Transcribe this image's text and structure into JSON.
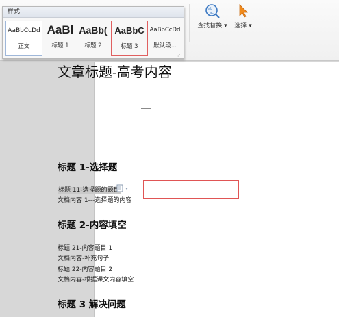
{
  "styles_panel": {
    "title": "样式",
    "items": [
      {
        "sample": "AaBbCcDd",
        "name": "正文"
      },
      {
        "sample": "AaBl",
        "name": "标题 1"
      },
      {
        "sample": "AaBb(",
        "name": "标题 2"
      },
      {
        "sample": "AaBbC",
        "name": "标题 3"
      },
      {
        "sample": "AaBbCcDd",
        "name": "默认段..."
      }
    ],
    "selected_index": 3
  },
  "toolbar": {
    "find_replace": "查找替换",
    "select": "选择"
  },
  "document": {
    "title": "文章标题-高考内容",
    "sections": [
      {
        "heading": "标题 1-选择题",
        "lines": [
          "标题 11-选择题的题目",
          "文档内容 1---选择题的内容"
        ]
      },
      {
        "heading": "标题 2-内容填空",
        "lines": [
          "标题 21-内容题目 1",
          "文档内容-补充句子",
          "标题 22-内容题目 2",
          "文档内容-根据课文内容填空"
        ]
      },
      {
        "heading": "标题 3 解决问题",
        "lines": []
      }
    ]
  },
  "colors": {
    "selection_outline": "#e05555",
    "icon_blue": "#3b78c2",
    "icon_orange": "#f08a1c"
  }
}
